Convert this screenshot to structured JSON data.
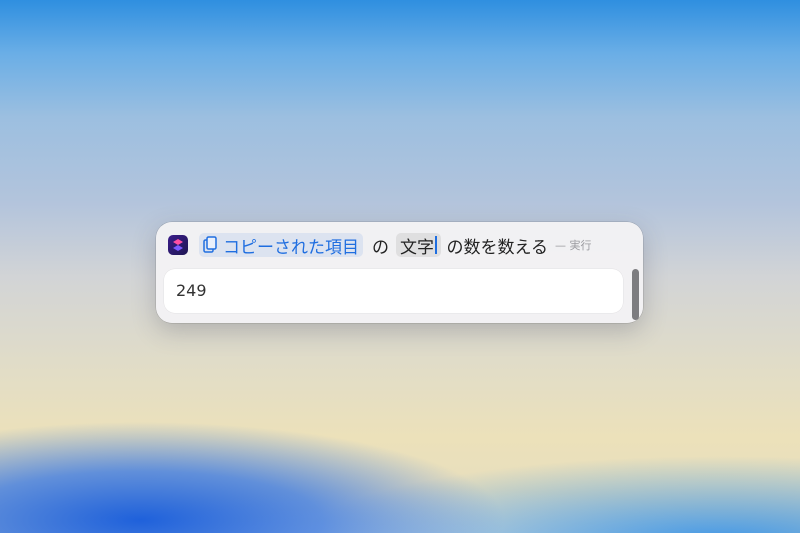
{
  "action_row": {
    "app_icon": "shortcuts-icon",
    "input_token": "コピーされた項目",
    "input_token_icon": "clipboard-icon",
    "particle_of": "の",
    "type_token": "文字",
    "action_text": "の数を数える",
    "run_label": "— 実行"
  },
  "result": {
    "value": "249"
  },
  "colors": {
    "accent": "#1f6ee0",
    "panel_background": "#f3f2f4"
  }
}
